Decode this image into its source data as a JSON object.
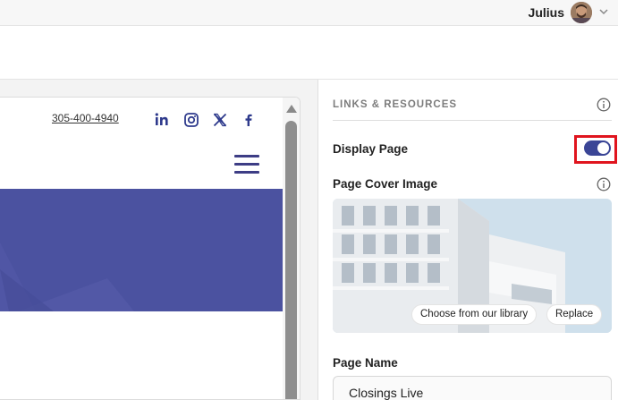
{
  "header": {
    "user_name": "Julius"
  },
  "preview": {
    "phone": "305-400-4940",
    "social_icons": [
      "linkedin-icon",
      "instagram-icon",
      "x-icon",
      "facebook-icon"
    ],
    "banner_color": "#4b52a0"
  },
  "panel": {
    "section_title": "LINKS & RESOURCES",
    "display_page_label": "Display Page",
    "display_page_enabled": true,
    "cover_label": "Page Cover Image",
    "choose_library_label": "Choose from our library",
    "replace_label": "Replace",
    "page_name_label": "Page Name",
    "page_name_value": "Closings Live"
  },
  "colors": {
    "accent": "#3a4596",
    "highlight": "#e0141e"
  }
}
